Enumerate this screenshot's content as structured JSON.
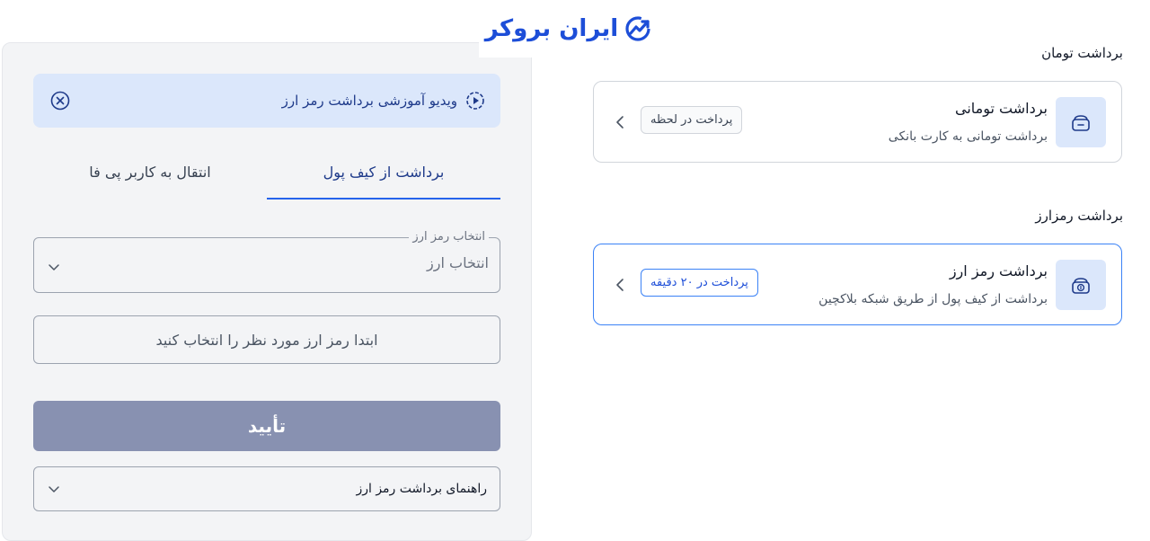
{
  "brand": {
    "name": "ایران بروکر",
    "color": "#1d4ed8"
  },
  "video_banner": {
    "title": "ویدیو آموزشی برداشت رمز ارز",
    "play_icon": "play-circle-icon",
    "close_icon": "close-circle-icon"
  },
  "tabs": [
    {
      "label": "برداشت از کیف پول",
      "active": true
    },
    {
      "label": "انتقال به کاربر پی فا",
      "active": false
    }
  ],
  "crypto_select": {
    "legend": "انتخاب رمز ارز",
    "value": "انتخاب ارز"
  },
  "info_message": "ابتدا رمز ارز مورد نظر را انتخاب کنید",
  "confirm_button": {
    "label": "تأیید"
  },
  "guide": {
    "label": "راهنمای برداشت رمز ارز"
  },
  "toman_section": {
    "title": "برداشت تومان",
    "card": {
      "title": "برداشت تومانی",
      "subtitle": "برداشت تومانی به کارت بانکی",
      "badge": "پرداخت در لحظه",
      "icon": "wallet-icon"
    }
  },
  "crypto_section": {
    "title": "برداشت رمزارز",
    "card": {
      "title": "برداشت رمز ارز",
      "subtitle": "برداشت از کیف پول از طریق شبکه بلاکچین",
      "badge": "پرداخت در ۲۰ دقیقه",
      "icon": "crypto-wallet-icon"
    }
  },
  "colors": {
    "accent": "#2563eb",
    "banner_bg": "#dbe7fb",
    "disabled_button": "#8891b1"
  }
}
